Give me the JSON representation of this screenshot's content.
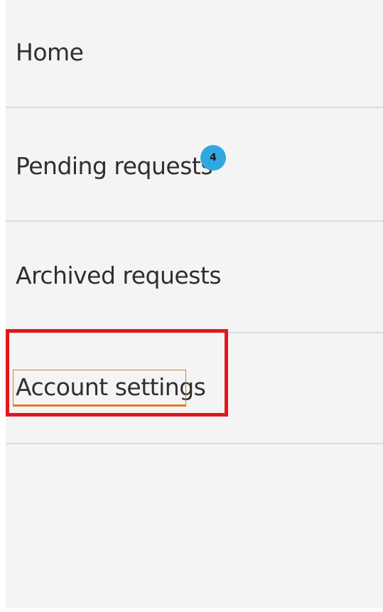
{
  "nav": {
    "items": [
      {
        "label": "Home"
      },
      {
        "label": "Pending requests",
        "badge": "4"
      },
      {
        "label": "Archived requests"
      },
      {
        "label": "Account settings",
        "focused": true,
        "highlighted": true
      }
    ]
  },
  "colors": {
    "panel_background": "#f4f4f4",
    "divider": "#dcdcdc",
    "badge": "#2fa8e1",
    "focus_outline": "#e07b2a",
    "highlight_box": "#e4161b",
    "text": "#2f2f2f"
  }
}
